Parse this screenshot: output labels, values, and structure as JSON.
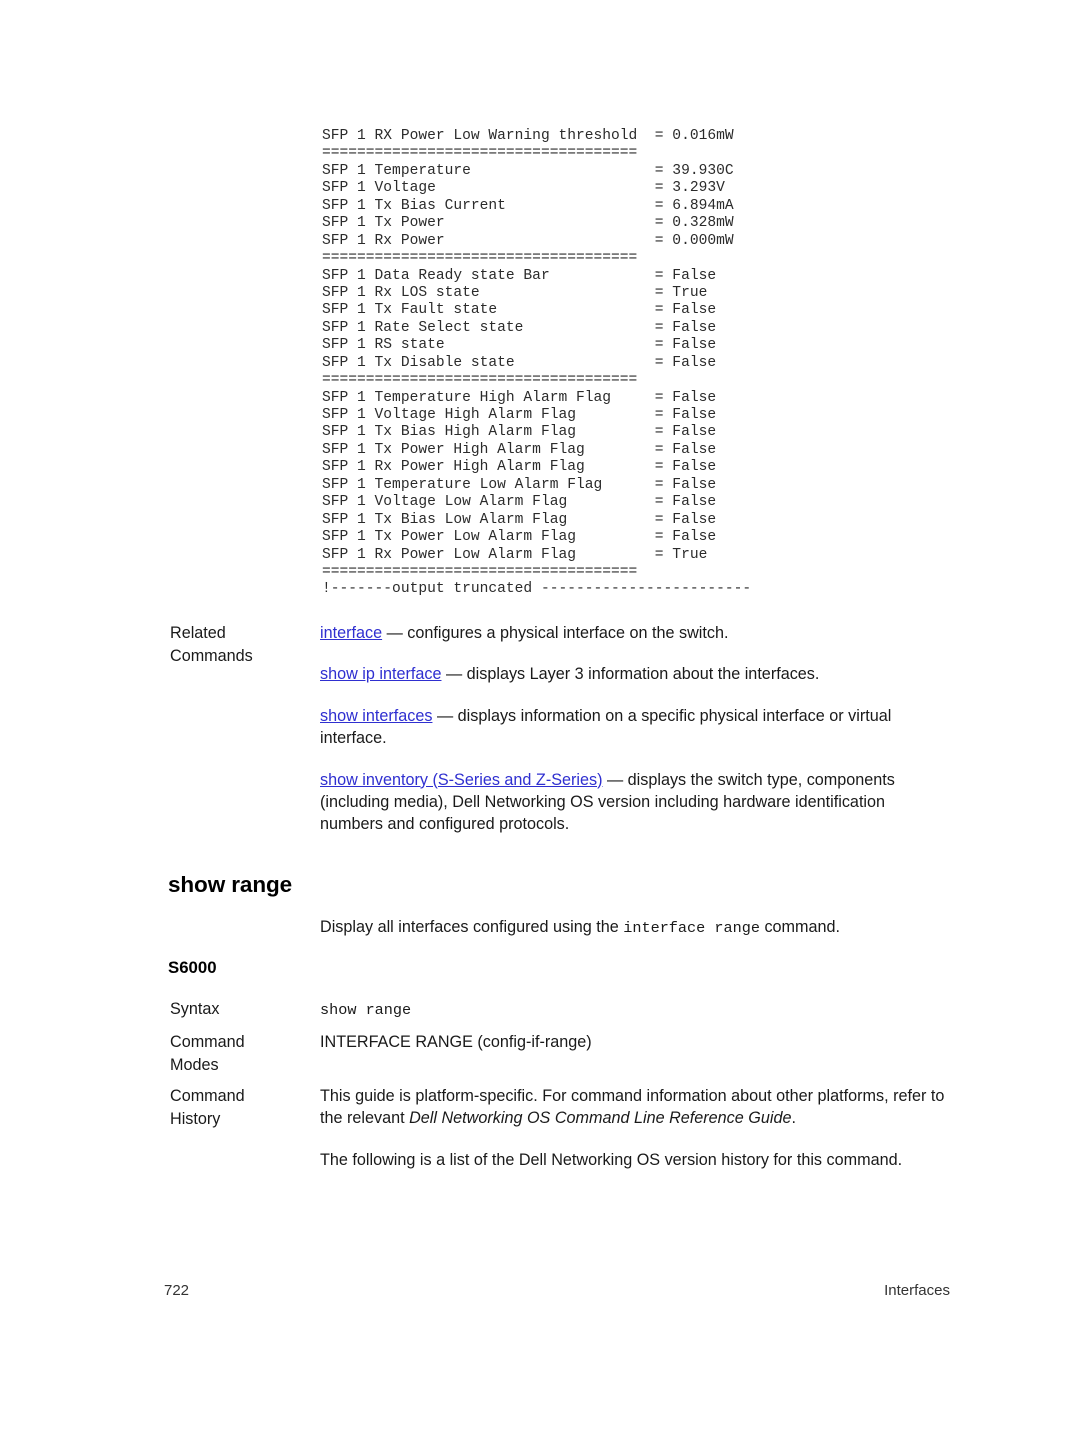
{
  "document": {
    "page_number": "722",
    "section_title": "Interfaces"
  },
  "cli_output": {
    "lines": [
      "SFP 1 RX Power Low Warning threshold  = 0.016mW",
      "====================================",
      "SFP 1 Temperature                     = 39.930C",
      "SFP 1 Voltage                         = 3.293V",
      "SFP 1 Tx Bias Current                 = 6.894mA",
      "SFP 1 Tx Power                        = 0.328mW",
      "SFP 1 Rx Power                        = 0.000mW",
      "====================================",
      "SFP 1 Data Ready state Bar            = False",
      "SFP 1 Rx LOS state                    = True",
      "SFP 1 Tx Fault state                  = False",
      "SFP 1 Rate Select state               = False",
      "SFP 1 RS state                        = False",
      "SFP 1 Tx Disable state                = False",
      "====================================",
      "SFP 1 Temperature High Alarm Flag     = False",
      "SFP 1 Voltage High Alarm Flag         = False",
      "SFP 1 Tx Bias High Alarm Flag         = False",
      "SFP 1 Tx Power High Alarm Flag        = False",
      "SFP 1 Rx Power High Alarm Flag        = False",
      "SFP 1 Temperature Low Alarm Flag      = False",
      "SFP 1 Voltage Low Alarm Flag          = False",
      "SFP 1 Tx Bias Low Alarm Flag          = False",
      "SFP 1 Tx Power Low Alarm Flag         = False",
      "SFP 1 Rx Power Low Alarm Flag         = True",
      "====================================",
      "!-------output truncated ------------------------"
    ]
  },
  "related_commands": {
    "label_line1": "Related",
    "label_line2": "Commands",
    "entries": [
      {
        "link": "interface",
        "description": " — configures a physical interface on the switch."
      },
      {
        "link": "show ip interface",
        "description": " — displays Layer 3 information about the interfaces."
      },
      {
        "link": "show interfaces",
        "description": " — displays information on a specific physical interface or virtual interface."
      },
      {
        "link": "show inventory (S-Series and Z-Series)",
        "description": " — displays the switch type, components (including media), Dell Networking OS version including hardware identification numbers and configured protocols."
      }
    ]
  },
  "command_section": {
    "heading": "show range",
    "description_before": "Display all interfaces configured using the ",
    "description_code": "interface range",
    "description_after": " command.",
    "platform": "S6000",
    "syntax": {
      "label": "Syntax",
      "value": "show range"
    },
    "command_modes": {
      "label_line1": "Command",
      "label_line2": "Modes",
      "value": "INTERFACE RANGE (config-if-range)"
    },
    "command_history": {
      "label_line1": "Command",
      "label_line2": "History",
      "paragraph1_before": "This guide is platform-specific. For command information about other platforms, refer to the relevant ",
      "paragraph1_italic": "Dell Networking OS Command Line Reference Guide",
      "paragraph1_after": ".",
      "paragraph2": "The following is a list of the Dell Networking OS version history for this command."
    }
  },
  "colors": {
    "link": "#2f2fd0",
    "text": "#1a1a1a",
    "code": "#2b2b2b"
  }
}
